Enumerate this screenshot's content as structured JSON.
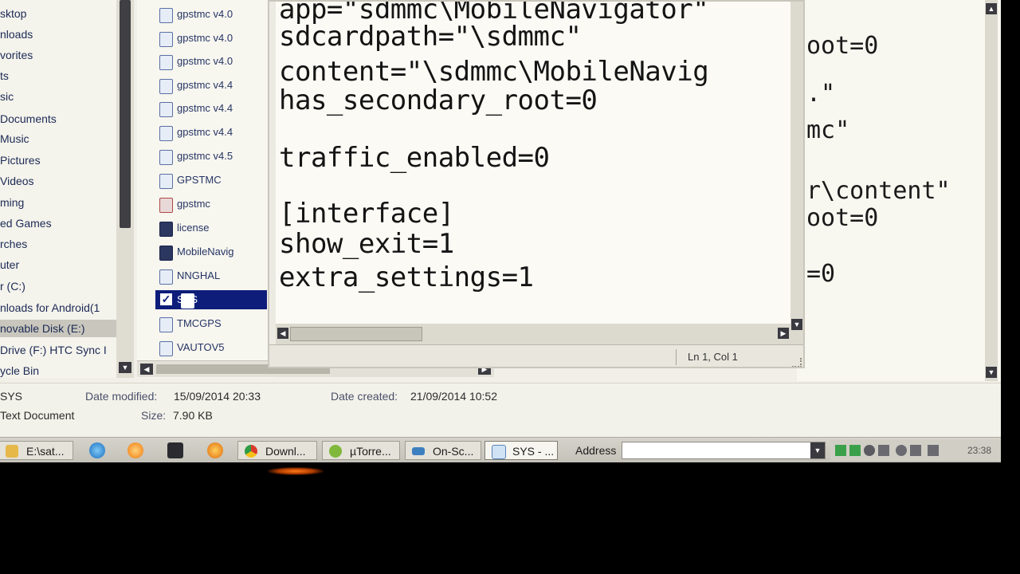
{
  "nav": {
    "items": [
      "sktop",
      "nloads",
      "vorites",
      "ts",
      "sic",
      "Documents",
      "Music",
      "Pictures",
      "Videos",
      "ming",
      "ed Games",
      "rches",
      "uter",
      "r (C:)",
      "nloads for Android(1",
      "novable Disk (E:)",
      "Drive (F:) HTC Sync I",
      "ycle Bin"
    ],
    "active_index": 15
  },
  "files": {
    "items": [
      "gpstmc v4.0",
      "gpstmc v4.0",
      "gpstmc v4.0",
      "gpstmc v4.4",
      "gpstmc v4.4",
      "gpstmc v4.4",
      "gpstmc v4.5",
      "GPSTMC",
      "gpstmc",
      "license",
      "MobileNavig",
      "NNGHAL",
      "SYS",
      "TMCGPS",
      "VAUTOV5"
    ],
    "selected_index": 12
  },
  "editor": {
    "lines": [
      "app=\"sdmmc\\MobileNavigator\"",
      "sdcardpath=\"\\sdmmc\"",
      "content=\"\\sdmmc\\MobileNavig",
      "has_secondary_root=0",
      "traffic_enabled=0",
      "[interface]",
      "show_exit=1",
      "extra_settings=1"
    ],
    "status": "Ln 1, Col 1"
  },
  "bg_editor": {
    "lines": [
      "oot=0",
      ".\"",
      "mc\"",
      "r\\content\"",
      "oot=0",
      "=0"
    ]
  },
  "details": {
    "name": "SYS",
    "type": "Text Document",
    "date_modified_label": "Date modified:",
    "date_modified": "15/09/2014 20:33",
    "date_created_label": "Date created:",
    "date_created": "21/09/2014 10:52",
    "size_label": "Size:",
    "size": "7.90 KB"
  },
  "taskbar": {
    "tasks": [
      "E:\\sat...",
      "Downl...",
      "µTorre...",
      "On-Sc...",
      "SYS - ..."
    ],
    "address_label": "Address",
    "clock": "23:38"
  }
}
